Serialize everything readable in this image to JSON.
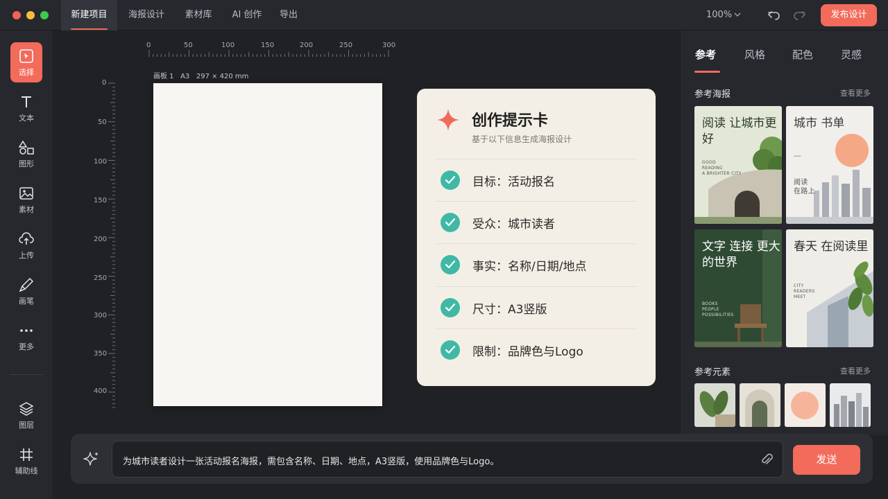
{
  "window": {
    "tabs": [
      {
        "label": "新建项目",
        "active": true
      },
      {
        "label": "海报设计"
      },
      {
        "label": "素材库"
      },
      {
        "label": "AI 创作"
      },
      {
        "label": "导出"
      }
    ],
    "zoom": "100%",
    "publish_label": "发布设计"
  },
  "toolbar": {
    "items": [
      {
        "label": "选择",
        "icon": "select-icon",
        "active": true
      },
      {
        "label": "文本",
        "icon": "text-icon"
      },
      {
        "label": "图形",
        "icon": "shapes-icon"
      },
      {
        "label": "素材",
        "icon": "image-icon"
      },
      {
        "label": "上传",
        "icon": "upload-icon"
      },
      {
        "label": "画笔",
        "icon": "brush-icon"
      },
      {
        "label": "更多",
        "icon": "more-icon"
      },
      {
        "label": "图层",
        "icon": "layers-icon"
      },
      {
        "label": "辅助线",
        "icon": "grid-icon"
      }
    ]
  },
  "canvas": {
    "ruler_h": [
      "0",
      "50",
      "100",
      "150",
      "200",
      "250",
      "300"
    ],
    "ruler_v": [
      "0",
      "50",
      "100",
      "150",
      "200",
      "250",
      "300",
      "350",
      "400"
    ],
    "artboard_name": "画板 1",
    "artboard_size": "A3",
    "artboard_dims": "297 × 420 mm"
  },
  "prompt_card": {
    "title": "创作提示卡",
    "subtitle": "基于以下信息生成海报设计",
    "items": [
      {
        "text": "目标：活动报名"
      },
      {
        "text": "受众：城市读者"
      },
      {
        "text": "事实：名称/日期/地点"
      },
      {
        "text": "尺寸：A3竖版"
      },
      {
        "text": "限制：品牌色与Logo"
      }
    ]
  },
  "right_panel": {
    "tabs": [
      "参考",
      "风格",
      "配色",
      "灵感"
    ],
    "active_tab": "参考",
    "posters_title": "参考海报",
    "posters_more": "查看更多",
    "posters": [
      {
        "title": "阅读\n让城市更好",
        "sub": "GOOD\nREADING\nA BRIGHTER CITY"
      },
      {
        "title": "城市\n书单",
        "dash": "—",
        "sub": "阅读\n在路上"
      },
      {
        "title": "文字\n连接\n更大的世界",
        "sub": "BOOKS\nPEOPLE\nPOSSIBILITIES"
      },
      {
        "title": "春天\n在阅读里",
        "sub": "CITY\nREADERS\nMEET"
      }
    ],
    "elements_title": "参考元素",
    "elements_more": "查看更多"
  },
  "prompt_bar": {
    "text": "为城市读者设计一张活动报名海报，需包含名称、日期、地点，A3竖版，使用品牌色与Logo。",
    "send_label": "发送"
  },
  "colors": {
    "accent": "#f26b5b",
    "check": "#3fb9a5",
    "card_bg": "#f4efe6"
  }
}
